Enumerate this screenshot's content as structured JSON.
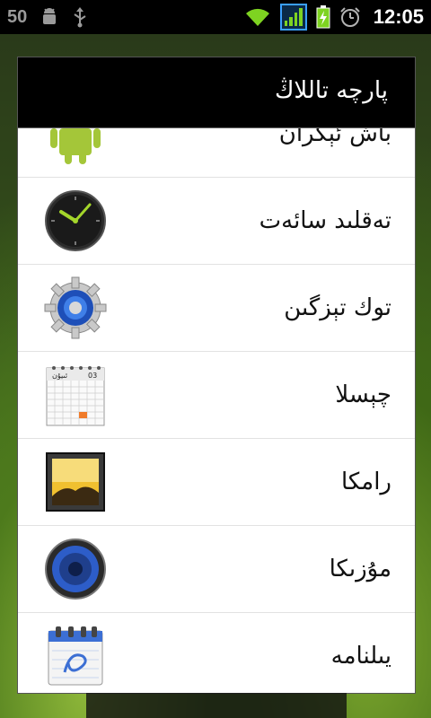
{
  "status_bar": {
    "notification_count": "50",
    "time": "12:05",
    "icons": [
      "android-debug-icon",
      "usb-icon",
      "wifi-icon",
      "cell-signal-icon",
      "battery-charging-icon",
      "alarm-clock-icon"
    ]
  },
  "dialog": {
    "title": "پارچە تاللاڭ",
    "items": [
      {
        "label": "باش ئېكران",
        "icon": "android-icon"
      },
      {
        "label": "تەقلىد سائەت",
        "icon": "analog-clock-icon"
      },
      {
        "label": "توك تېزگىن",
        "icon": "settings-gear-icon"
      },
      {
        "label": "چېسلا",
        "icon": "calendar-icon"
      },
      {
        "label": "رامكا",
        "icon": "picture-frame-icon"
      },
      {
        "label": "مۇزىكا",
        "icon": "speaker-icon"
      },
      {
        "label": "يىلنامە",
        "icon": "notebook-icon"
      }
    ]
  },
  "calendar_icon": {
    "day": "03",
    "month": "ئىيۇن"
  },
  "colors": {
    "accent": "#3aa0ff",
    "signal": "#7ed321"
  }
}
